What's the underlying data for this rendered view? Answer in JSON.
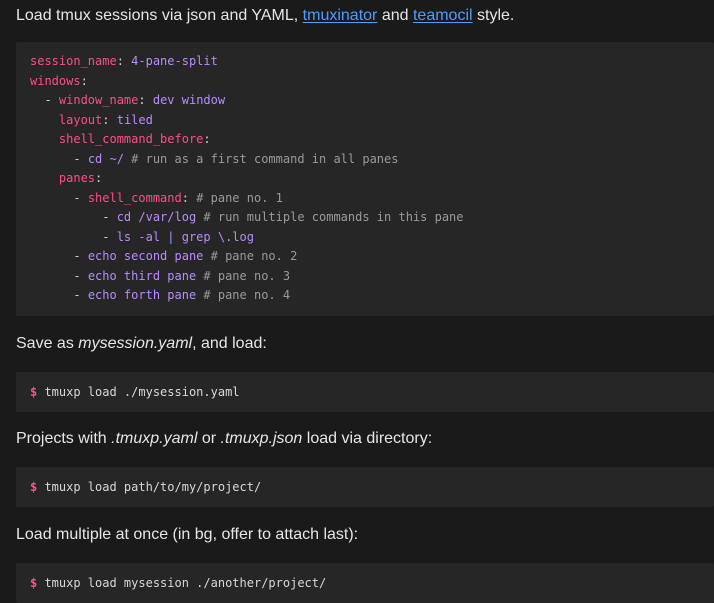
{
  "intro": {
    "prefix": "Load tmux sessions via json and YAML, ",
    "link1": "tmuxinator",
    "mid": " and ",
    "link2": "teamocil",
    "suffix": " style."
  },
  "yaml_block": {
    "line1": {
      "key": "session_name",
      "sep": ": ",
      "val": "4-pane-split"
    },
    "line2": {
      "key": "windows",
      "sep": ":"
    },
    "line3": {
      "dash": "- ",
      "key": "window_name",
      "sep": ": ",
      "val": "dev window"
    },
    "line4": {
      "key": "layout",
      "sep": ": ",
      "val": "tiled"
    },
    "line5": {
      "key": "shell_command_before",
      "sep": ":"
    },
    "line6": {
      "dash": "- ",
      "val": "cd ~/",
      "comment": " # run as a first command in all panes"
    },
    "line7": {
      "key": "panes",
      "sep": ":"
    },
    "line8": {
      "dash": "- ",
      "key": "shell_command",
      "sep": ": ",
      "comment": "# pane no. 1"
    },
    "line9": {
      "dash": "- ",
      "val": "cd /var/log",
      "comment": " # run multiple commands in this pane"
    },
    "line10": {
      "dash": "- ",
      "val": "ls -al | grep \\.log"
    },
    "line11": {
      "dash": "- ",
      "val": "echo second pane",
      "comment": " # pane no. 2"
    },
    "line12": {
      "dash": "- ",
      "val": "echo third pane",
      "comment": " # pane no. 3"
    },
    "line13": {
      "dash": "- ",
      "val": "echo forth pane",
      "comment": " # pane no. 4"
    }
  },
  "save_para": {
    "prefix": "Save as ",
    "file": "mysession.yaml",
    "suffix": ", and load:"
  },
  "cmd1": {
    "prompt": "$",
    "text": " tmuxp load ./mysession.yaml"
  },
  "projects_para": {
    "prefix": "Projects with ",
    "file1": ".tmuxp.yaml",
    "mid": " or ",
    "file2": ".tmuxp.json",
    "suffix": " load via directory:"
  },
  "cmd2": {
    "prompt": "$",
    "text": " tmuxp load path/to/my/project/"
  },
  "multi_para": {
    "text": "Load multiple at once (in bg, offer to attach last):"
  },
  "cmd3": {
    "prompt": "$",
    "text": " tmuxp load mysession ./another/project/"
  }
}
